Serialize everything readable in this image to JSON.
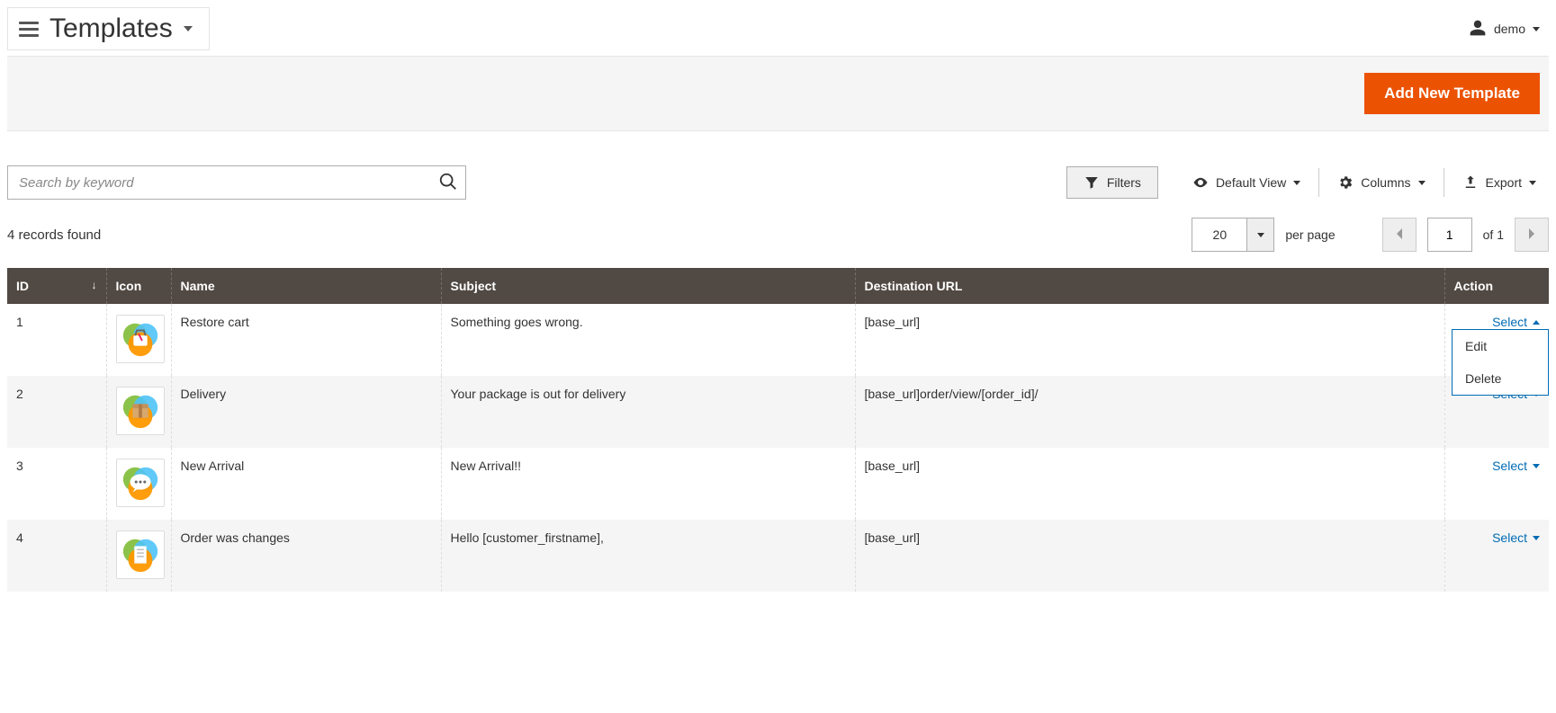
{
  "header": {
    "title": "Templates",
    "user_name": "demo"
  },
  "actions": {
    "add_new_label": "Add New Template"
  },
  "search": {
    "placeholder": "Search by keyword"
  },
  "toolbar": {
    "filters_label": "Filters",
    "default_view_label": "Default View",
    "columns_label": "Columns",
    "export_label": "Export"
  },
  "pagination": {
    "records_found_text": "4 records found",
    "per_page_value": "20",
    "per_page_label": "per page",
    "current_page": "1",
    "of_label": "of",
    "total_pages": "1"
  },
  "columns": {
    "id": "ID",
    "icon": "Icon",
    "name": "Name",
    "subject": "Subject",
    "destination_url": "Destination URL",
    "action": "Action"
  },
  "action_select_label": "Select",
  "action_menu": {
    "edit": "Edit",
    "delete": "Delete"
  },
  "rows": [
    {
      "id": "1",
      "icon": "cart-icon",
      "name": "Restore cart",
      "subject": "Something goes wrong.",
      "destination_url": "[base_url]",
      "menu_open": true
    },
    {
      "id": "2",
      "icon": "package-icon",
      "name": "Delivery",
      "subject": "Your package is out for delivery",
      "destination_url": "[base_url]order/view/[order_id]/",
      "menu_open": false
    },
    {
      "id": "3",
      "icon": "chat-icon",
      "name": "New Arrival",
      "subject": "New Arrival!!",
      "destination_url": "[base_url]",
      "menu_open": false
    },
    {
      "id": "4",
      "icon": "receipt-icon",
      "name": "Order was changes",
      "subject": "Hello [customer_firstname],",
      "destination_url": "[base_url]",
      "menu_open": false
    }
  ]
}
